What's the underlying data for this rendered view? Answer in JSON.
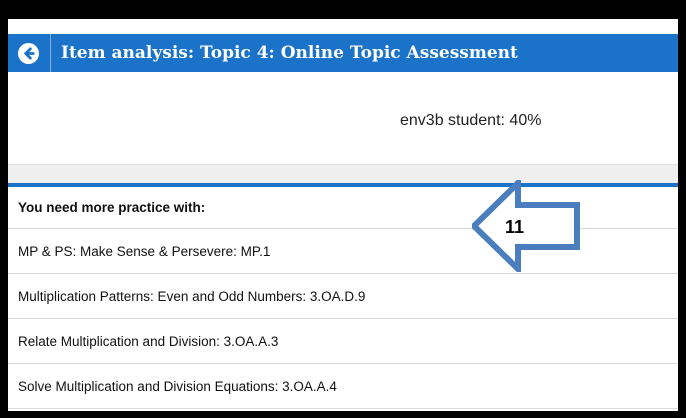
{
  "header": {
    "back_icon": "back-arrow-circle-icon",
    "title": "Item analysis: Topic 4: Online Topic Assessment"
  },
  "score_text": "env3b student: 40%",
  "practice": {
    "heading": "You need more practice with:",
    "items": [
      "MP & PS: Make Sense & Persevere: MP.1",
      "Multiplication Patterns: Even and Odd Numbers: 3.OA.D.9",
      "Relate Multiplication and Division: 3.OA.A.3",
      "Solve Multiplication and Division Equations: 3.OA.A.4"
    ]
  },
  "annotation": {
    "number": "11",
    "icon": "left-arrow-outline-icon",
    "color": "#4a7ebf"
  },
  "colors": {
    "accent": "#1a73c8"
  }
}
